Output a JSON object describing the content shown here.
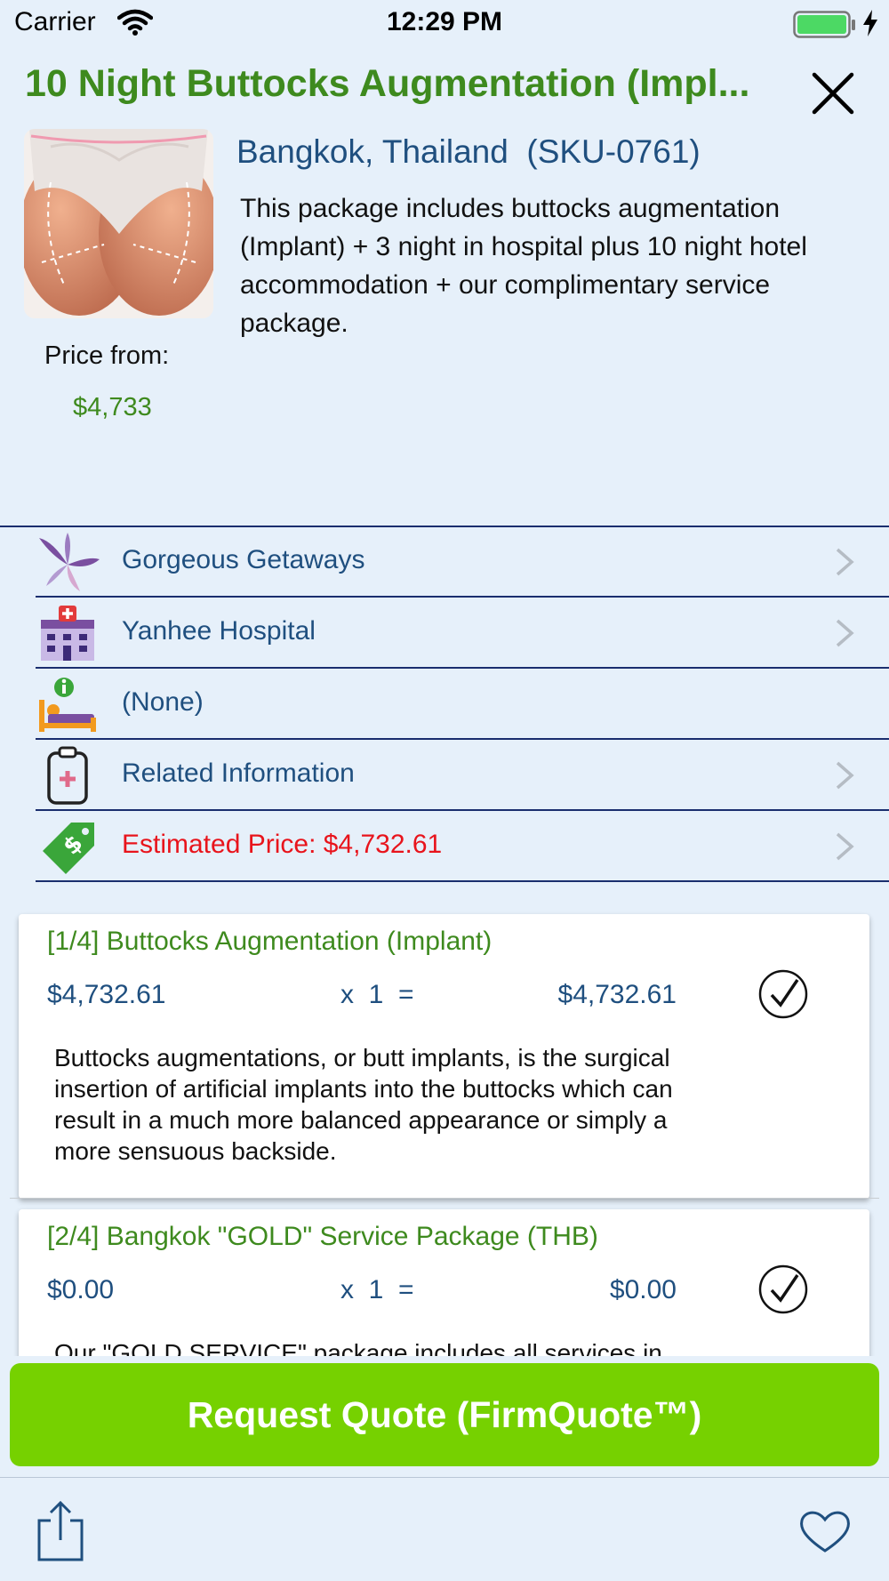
{
  "status_bar": {
    "carrier": "Carrier",
    "time": "12:29 PM"
  },
  "header": {
    "title": "10 Night Buttocks Augmentation (Impl..."
  },
  "package": {
    "location": "Bangkok, Thailand  (SKU-0761)",
    "description": "This package includes buttocks augmentation (Implant) + 3 night in hospital plus 10 night hotel accommodation + our complimentary service package.",
    "price_label": "Price from:",
    "price_value": "$4,733"
  },
  "info_rows": [
    {
      "label": "Gorgeous Getaways",
      "icon": "flower-logo-icon"
    },
    {
      "label": "Yanhee Hospital",
      "icon": "hospital-icon"
    },
    {
      "label": "(None)",
      "icon": "hotel-bed-icon"
    },
    {
      "label": "Related Information",
      "icon": "clipboard-medical-icon"
    },
    {
      "label": "Estimated Price: $4,732.61",
      "icon": "price-tag-icon"
    }
  ],
  "items": [
    {
      "title": "[1/4] Buttocks Augmentation (Implant)",
      "price": "$4,732.61",
      "qty": "x  1  =",
      "total": "$4,732.61",
      "description": "Buttocks augmentations, or butt implants, is the surgical insertion of artificial implants into the buttocks which can result in a much more balanced appearance or simply a more sensuous backside."
    },
    {
      "title": "[2/4] Bangkok \"GOLD\" Service Package (THB)",
      "price": "$0.00",
      "qty": "x  1  =",
      "total": "$0.00",
      "description": "Our \"GOLD SERVICE\" package includes all services in"
    }
  ],
  "cta": {
    "label": "Request Quote (FirmQuote™)"
  },
  "colors": {
    "accent_green": "#3e8a1e",
    "cta_green": "#76d100",
    "link_blue": "#1f4f7f",
    "alert_red": "#e8141c",
    "background": "#e6f0fa"
  }
}
